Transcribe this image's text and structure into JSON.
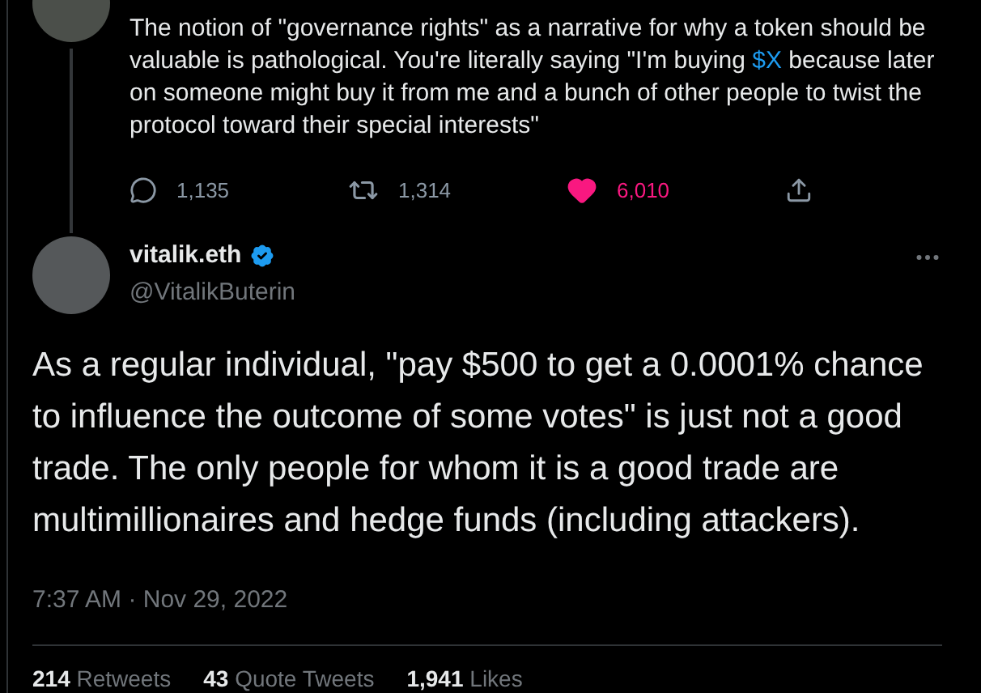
{
  "parent_tweet": {
    "text": [
      {
        "kind": "text",
        "text": "The notion of \"governance rights\" as a narrative for why a token should be valuable is pathological. You're literally saying \"I'm buying "
      },
      {
        "kind": "link",
        "text": "$X"
      },
      {
        "kind": "text",
        "text": " because later on someone might buy it from me and a bunch of other people to twist the protocol toward their special interests\""
      }
    ],
    "actions": [
      {
        "kind": "reply",
        "count": "1,135",
        "active": false
      },
      {
        "kind": "retweet",
        "count": "1,314",
        "active": false
      },
      {
        "kind": "like",
        "count": "6,010",
        "active": true
      },
      {
        "kind": "share"
      }
    ]
  },
  "tweet": {
    "name": "vitalik.eth",
    "verified": true,
    "handle": "@VitalikButerin",
    "text": "As a regular individual, \"pay $500 to get a 0.0001% chance to influence the outcome of some votes\" is just not a good trade. The only people for whom it is a good trade are multimillionaires and hedge funds (including attackers).",
    "timestamp": "7:37 AM · Nov 29, 2022",
    "stats": [
      {
        "count": "214",
        "label": "Retweets"
      },
      {
        "count": "43",
        "label": "Quote Tweets"
      },
      {
        "count": "1,941",
        "label": "Likes"
      }
    ]
  }
}
